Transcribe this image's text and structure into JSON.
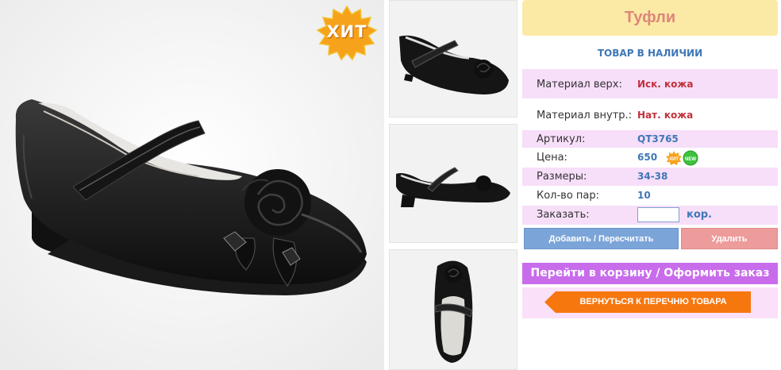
{
  "badge": {
    "hit": "ХИТ"
  },
  "product": {
    "title": "Туфли",
    "stock_status": "ТОВАР В НАЛИЧИИ",
    "upper_material_label": "Материал верх:",
    "upper_material": "Иск. кожа",
    "inner_material_label": "Материал внутр.:",
    "inner_material": "Нат. кожа",
    "article_label": "Артикул:",
    "article": "QT3765",
    "price_label": "Цена:",
    "price": "650",
    "sizes_label": "Размеры:",
    "sizes": "34-38",
    "pairs_label": "Кол-во пар:",
    "pairs": "10",
    "order_label": "Заказать:",
    "order_value": "",
    "currency": "кор."
  },
  "mini_badges": {
    "hit": "ХИТ",
    "new": "NEW"
  },
  "actions": {
    "add_label": "Добавить / Пересчитать",
    "delete_label": "Удалить",
    "cart_label": "Перейти в корзину / Оформить заказ",
    "back_label": "ВЕРНУТЬСЯ К ПЕРЕЧНЮ ТОВАРА"
  },
  "icons": {
    "hit_badge": "starburst-badge-icon",
    "new_badge": "new-badge-icon",
    "back_arrow": "left-arrow-icon"
  },
  "colors": {
    "title_bg": "#fbeaa6",
    "title_text": "#e0857a",
    "row_pink": "#f7def9",
    "accent_blue": "#3f77b6",
    "accent_red": "#c0303a",
    "add_button": "#7ba4d8",
    "delete_button": "#ee9b9b",
    "cart_bar": "#c86cec",
    "back_button": "#f7770f",
    "hit_badge": "#f7a21b"
  }
}
